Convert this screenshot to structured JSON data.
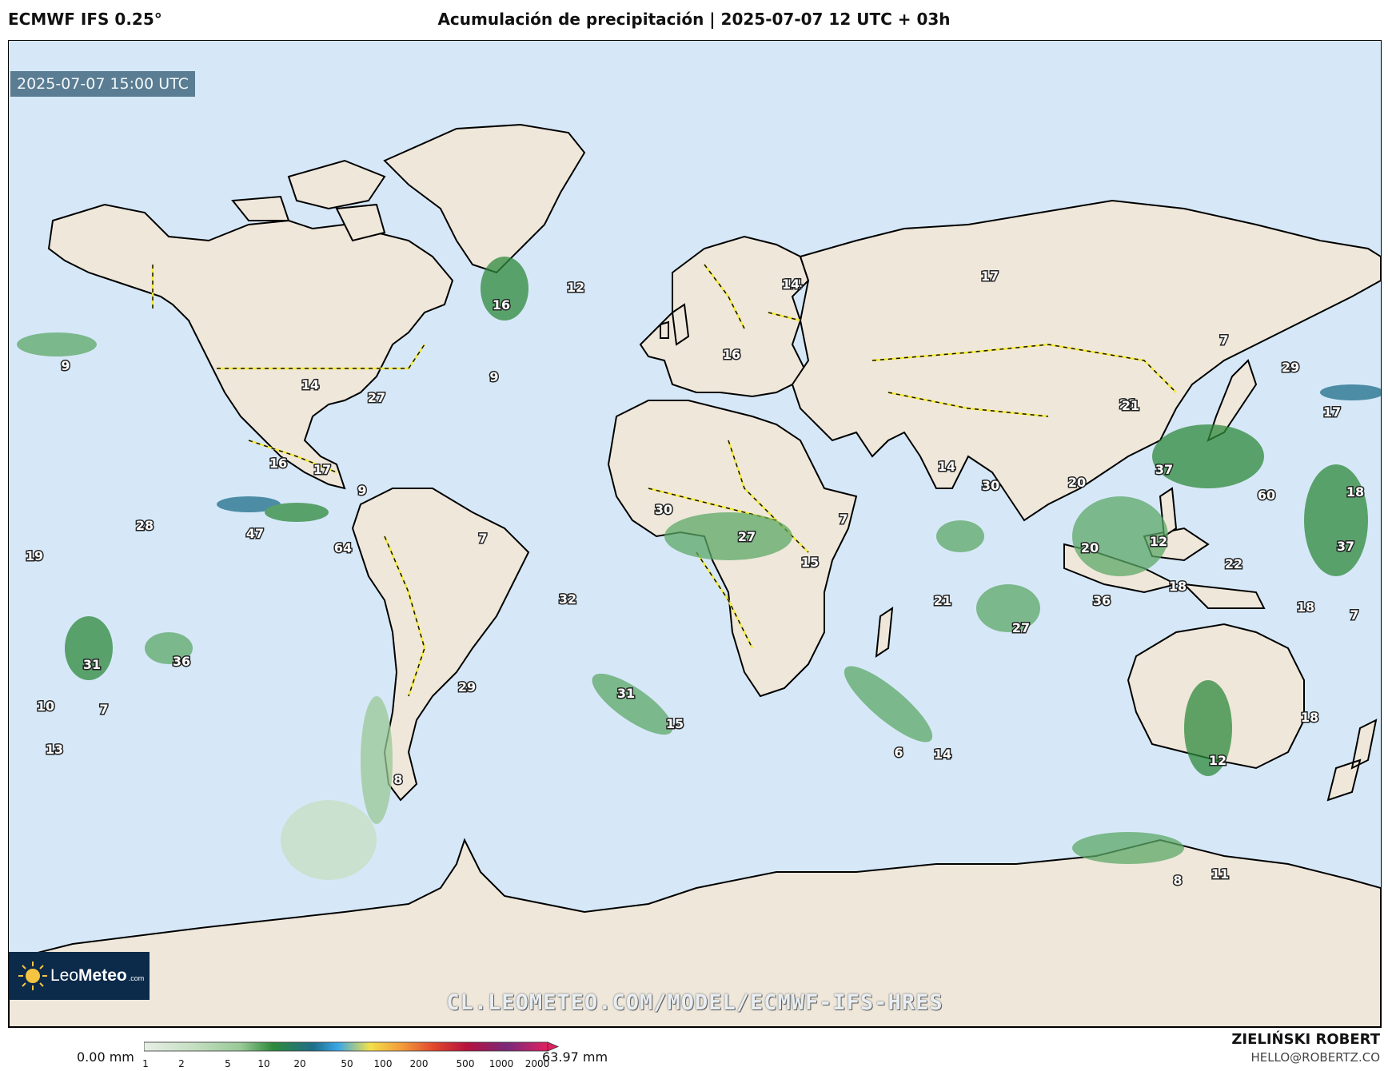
{
  "header": {
    "model": "ECMWF IFS 0.25°",
    "title": "Acumulación de precipitación | 2025-07-07 12 UTC + 03h"
  },
  "map": {
    "valid_time": "2025-07-07 15:00 UTC",
    "watermark_url": "CL.LEOMETEO.COM/MODEL/ECMWF-IFS-HRES",
    "ocean_color": "#d6e8f8",
    "land_color": "#efe7da",
    "border_color": "#f5ea3a",
    "precip_color": "#2f8a3c",
    "labels": [
      {
        "text": "16"
      },
      {
        "text": "12"
      },
      {
        "text": "17"
      },
      {
        "text": "14"
      },
      {
        "text": "9"
      },
      {
        "text": "14"
      },
      {
        "text": "27"
      },
      {
        "text": "9"
      },
      {
        "text": "16"
      },
      {
        "text": "17"
      },
      {
        "text": "9"
      },
      {
        "text": "28"
      },
      {
        "text": "47"
      },
      {
        "text": "64"
      },
      {
        "text": "19"
      },
      {
        "text": "7"
      },
      {
        "text": "32"
      },
      {
        "text": "31"
      },
      {
        "text": "36"
      },
      {
        "text": "10"
      },
      {
        "text": "7"
      },
      {
        "text": "13"
      },
      {
        "text": "29"
      },
      {
        "text": "8"
      },
      {
        "text": "31"
      },
      {
        "text": "15"
      },
      {
        "text": "30"
      },
      {
        "text": "27"
      },
      {
        "text": "7"
      },
      {
        "text": "15"
      },
      {
        "text": "16"
      },
      {
        "text": "14"
      },
      {
        "text": "14"
      },
      {
        "text": "30"
      },
      {
        "text": "21"
      },
      {
        "text": "7"
      },
      {
        "text": "29"
      },
      {
        "text": "21"
      },
      {
        "text": "17"
      },
      {
        "text": "37"
      },
      {
        "text": "20"
      },
      {
        "text": "60"
      },
      {
        "text": "18"
      },
      {
        "text": "20"
      },
      {
        "text": "12"
      },
      {
        "text": "37"
      },
      {
        "text": "22"
      },
      {
        "text": "18"
      },
      {
        "text": "36"
      },
      {
        "text": "21"
      },
      {
        "text": "27"
      },
      {
        "text": "18"
      },
      {
        "text": "7"
      },
      {
        "text": "6"
      },
      {
        "text": "14"
      },
      {
        "text": "18"
      },
      {
        "text": "12"
      },
      {
        "text": "8"
      },
      {
        "text": "11"
      }
    ]
  },
  "logo": {
    "brand_light": "Leo",
    "brand_bold": "Meteo",
    "suffix": ".com",
    "icon": "sun-icon"
  },
  "colorbar": {
    "min_label": "0.00 mm",
    "max_label": "63.97 mm",
    "ticks": [
      "1",
      "2",
      "5",
      "10",
      "20",
      "50",
      "100",
      "200",
      "500",
      "1000",
      "2000"
    ],
    "colors": [
      "#e6efe6",
      "#c6dfc2",
      "#98c996",
      "#5da867",
      "#2f8a3c",
      "#1e6e8a",
      "#2a55c4",
      "#3aa6e6",
      "#f2e04a",
      "#f29a3a",
      "#e0452e",
      "#b5123e",
      "#7a2a7a",
      "#e02060"
    ]
  },
  "credits": {
    "name": "ZIELIŃSKI ROBERT",
    "email": "HELLO@ROBERTZ.CO"
  }
}
